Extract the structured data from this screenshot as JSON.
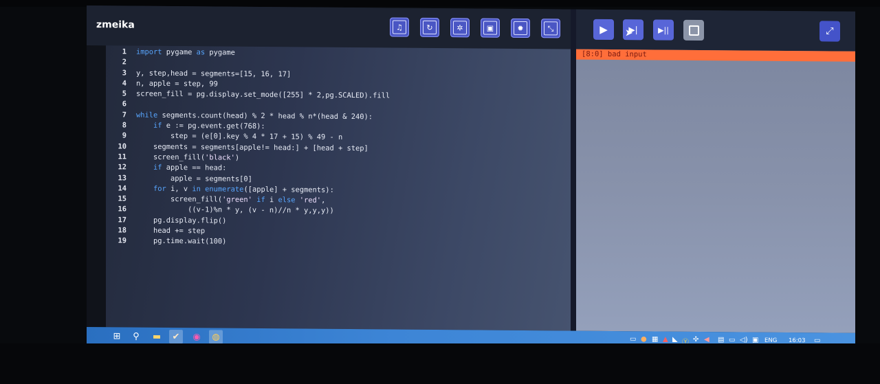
{
  "app": {
    "title": "zmeika"
  },
  "toolbar": {
    "tools": [
      {
        "icon": "music-icon",
        "glyph": "♫"
      },
      {
        "icon": "refresh-icon",
        "glyph": "↻"
      },
      {
        "icon": "bug-icon",
        "glyph": "✲"
      },
      {
        "icon": "save-icon",
        "glyph": "▣"
      },
      {
        "icon": "settings-icon",
        "glyph": "✹"
      },
      {
        "icon": "resize-icon",
        "glyph": "⤡"
      }
    ],
    "run": {
      "icon": "play-icon",
      "glyph": "▶"
    },
    "step": {
      "icon": "step-icon",
      "glyph": "▶|"
    },
    "step_all": {
      "icon": "step-all-icon",
      "glyph": "▶||"
    },
    "stop": {
      "icon": "stop-icon"
    },
    "fullscreen": {
      "icon": "fullscreen-icon",
      "glyph": "⤢"
    }
  },
  "output": {
    "error": "[8:0] bad input"
  },
  "code": [
    {
      "n": "1",
      "t": "import pygame as pygame"
    },
    {
      "n": "2",
      "t": ""
    },
    {
      "n": "3",
      "t": "y, step,head = segments=[15, 16, 17]"
    },
    {
      "n": "4",
      "t": "n, apple = step, 99"
    },
    {
      "n": "5",
      "t": "screen_fill = pg.display.set_mode([255] * 2,pg.SCALED).fill"
    },
    {
      "n": "6",
      "t": ""
    },
    {
      "n": "7",
      "t": "while segments.count(head) % 2 * head % n*(head & 240):"
    },
    {
      "n": "8",
      "t": "    if e := pg.event.get(768):"
    },
    {
      "n": "9",
      "t": "        step = (e[0].key % 4 * 17 + 15) % 49 - n"
    },
    {
      "n": "10",
      "t": "    segments = segments[apple!= head:] + [head + step]"
    },
    {
      "n": "11",
      "t": "    screen_fill('black')"
    },
    {
      "n": "12",
      "t": "    if apple == head:"
    },
    {
      "n": "13",
      "t": "        apple = segments[0]"
    },
    {
      "n": "14",
      "t": "    for i, v in enumerate([apple] + segments):"
    },
    {
      "n": "15",
      "t": "        screen_fill('green' if i else 'red',"
    },
    {
      "n": "16",
      "t": "            ((v-1)%n * y, (v - n)//n * y,y,y))"
    },
    {
      "n": "17",
      "t": "    pg.display.flip()"
    },
    {
      "n": "18",
      "t": "    head += step"
    },
    {
      "n": "19",
      "t": "    pg.time.wait(100)"
    }
  ],
  "taskbar": {
    "lang": "ENG",
    "time": "16:03"
  }
}
